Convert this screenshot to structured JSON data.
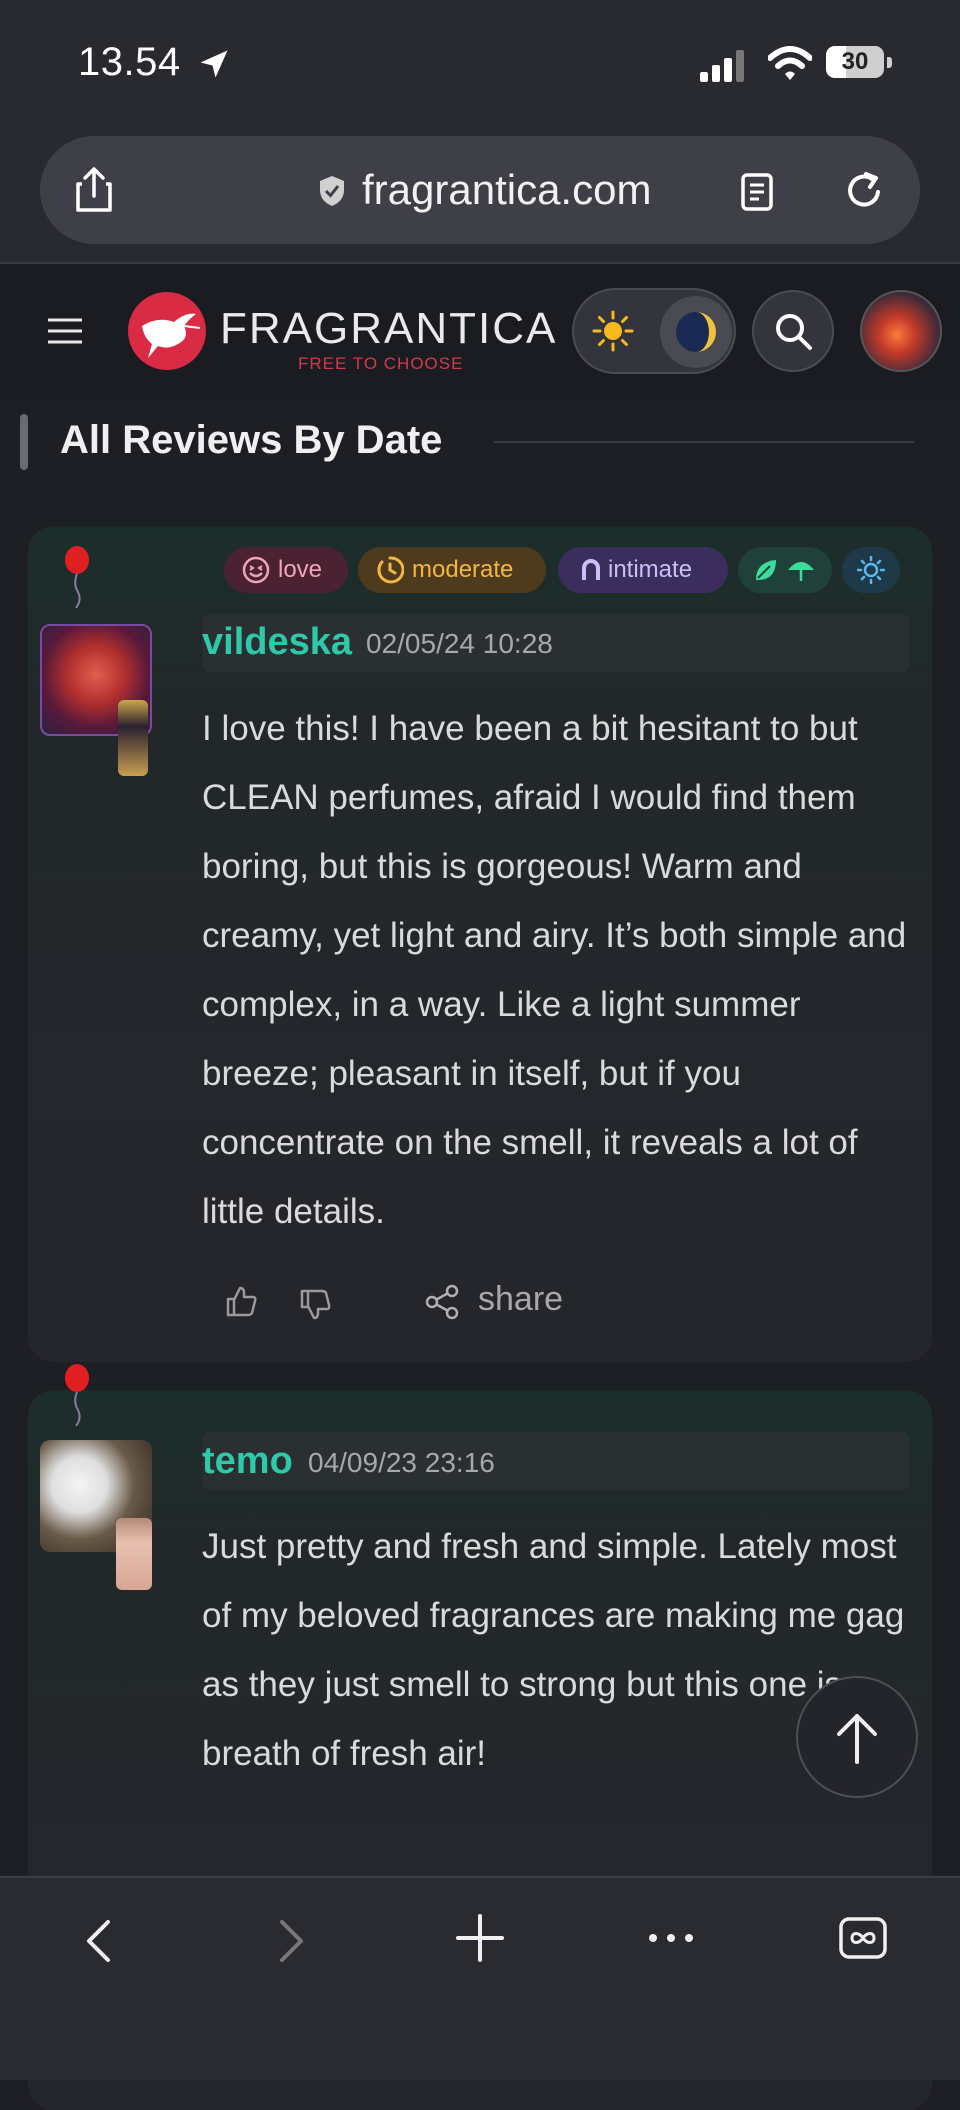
{
  "status_bar": {
    "time": "13.54",
    "battery": "30"
  },
  "browser": {
    "url": "fragrantica.com"
  },
  "site": {
    "brand": "FRAGRANTICA",
    "tagline": "FREE TO CHOOSE"
  },
  "section": {
    "title": "All Reviews By Date"
  },
  "reviews": [
    {
      "username": "vildeska",
      "date": "02/05/24 10:28",
      "chips": {
        "love": "love",
        "moderate": "moderate",
        "intimate": "intimate"
      },
      "text": "I love this! I have been a bit hesitant to but CLEAN perfumes, afraid I would find them boring, but this is gorgeous! Warm and creamy, yet light and airy. It’s both simple and complex, in a way. Like a light summer breeze; pleasant in itself, but if you concentrate on the smell, it reveals a lot of little details.",
      "share_label": "share"
    },
    {
      "username": "temo",
      "date": "04/09/23 23:16",
      "text": "Just pretty and fresh and simple. Lately most of my beloved fragrances are making me gag as they just smell to strong but this one is a breath of fresh air!"
    }
  ],
  "colors": {
    "accent": "#2dc9a8",
    "brand_red": "#d92b44",
    "background": "#1e1f25"
  },
  "icons": [
    "location-arrow-icon",
    "signal-icon",
    "wifi-icon",
    "share-icon",
    "shield-icon",
    "reader-icon",
    "reload-icon",
    "hamburger-icon",
    "sun-icon",
    "moon-icon",
    "search-icon",
    "thumbs-up-icon",
    "thumbs-down-icon",
    "arrow-up-icon",
    "back-icon",
    "forward-icon",
    "plus-icon",
    "more-icon",
    "tabs-icon"
  ]
}
